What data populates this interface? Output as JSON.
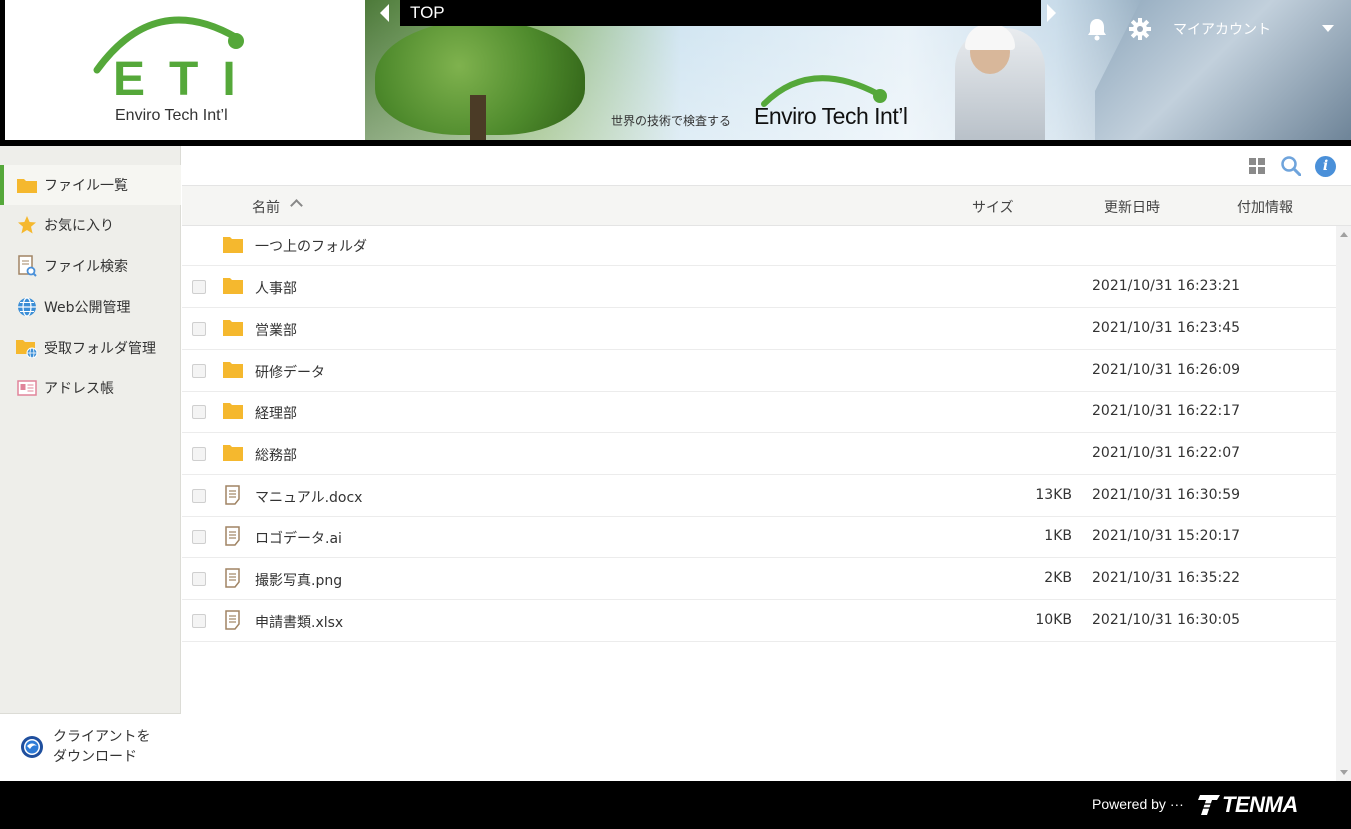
{
  "header": {
    "logo_letters": "ETI",
    "logo_subtitle": "Enviro Tech Int’l",
    "banner_tagline": "世界の技術で検査する",
    "banner_brand": "Enviro Tech Int’l",
    "title": "TOP",
    "account_label": "マイアカウント",
    "accent_color": "#55a83a"
  },
  "sidebar": {
    "items": [
      {
        "label": "ファイル一覧",
        "icon": "folder-icon"
      },
      {
        "label": "お気に入り",
        "icon": "star-icon"
      },
      {
        "label": "ファイル検索",
        "icon": "file-search-icon"
      },
      {
        "label": "Web公開管理",
        "icon": "globe-icon"
      },
      {
        "label": "受取フォルダ管理",
        "icon": "folder-globe-icon"
      },
      {
        "label": "アドレス帳",
        "icon": "address-card-icon"
      }
    ],
    "download_label": "クライアントを\nダウンロード"
  },
  "table": {
    "columns": {
      "name": "名前",
      "size": "サイズ",
      "updated": "更新日時",
      "extra": "付加情報"
    },
    "parent_folder": "一つ上のフォルダ",
    "rows": [
      {
        "name": "人事部",
        "type": "folder",
        "size": "",
        "updated": "2021/10/31 16:23:21"
      },
      {
        "name": "営業部",
        "type": "folder",
        "size": "",
        "updated": "2021/10/31 16:23:45"
      },
      {
        "name": "研修データ",
        "type": "folder",
        "size": "",
        "updated": "2021/10/31 16:26:09"
      },
      {
        "name": "経理部",
        "type": "folder",
        "size": "",
        "updated": "2021/10/31 16:22:17"
      },
      {
        "name": "総務部",
        "type": "folder",
        "size": "",
        "updated": "2021/10/31 16:22:07"
      },
      {
        "name": "マニュアル.docx",
        "type": "file",
        "size": "13KB",
        "updated": "2021/10/31 16:30:59"
      },
      {
        "name": "ロゴデータ.ai",
        "type": "file",
        "size": "1KB",
        "updated": "2021/10/31 15:20:17"
      },
      {
        "name": "撮影写真.png",
        "type": "file",
        "size": "2KB",
        "updated": "2021/10/31 16:35:22"
      },
      {
        "name": "申請書類.xlsx",
        "type": "file",
        "size": "10KB",
        "updated": "2021/10/31 16:30:05"
      }
    ]
  },
  "footer": {
    "powered_by": "Powered by ···",
    "brand": "TENMA"
  }
}
